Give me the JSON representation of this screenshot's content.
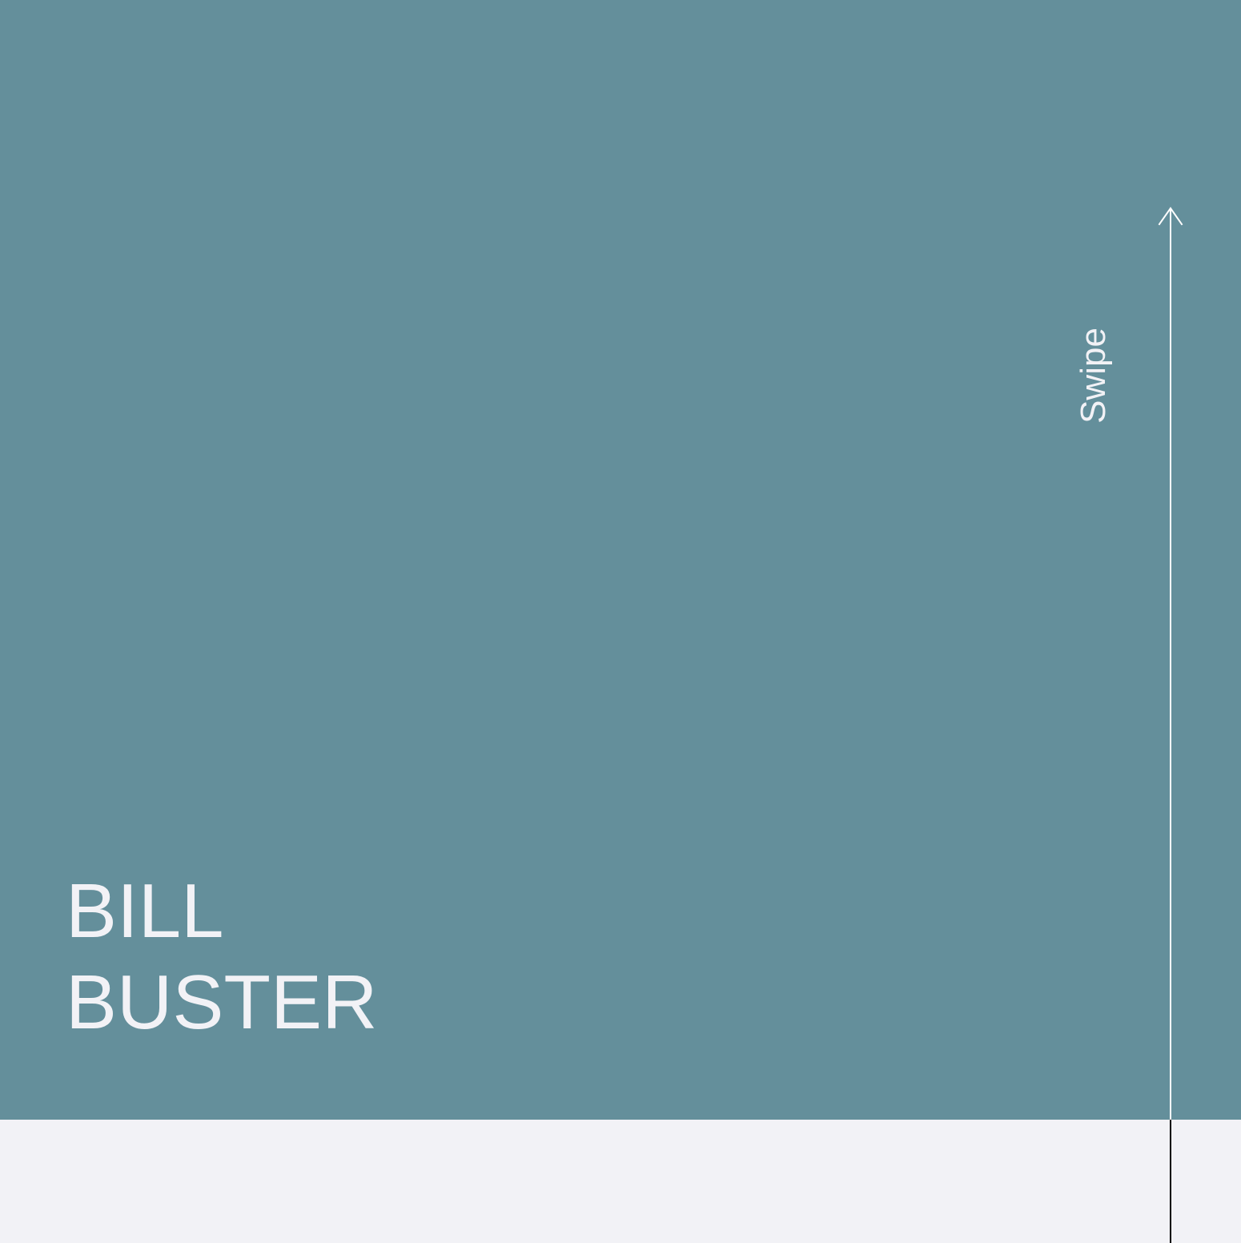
{
  "colors": {
    "hero_background": "#648f9b",
    "bottom_background": "#f2f2f6",
    "text": "#f2f2f6",
    "arrow_on_hero": "#ffffff",
    "arrow_on_bottom": "#000000"
  },
  "title": {
    "line1": "BILL",
    "line2": "BUSTER"
  },
  "swipe": {
    "label": "Swipe",
    "icon": "arrow-up-icon"
  }
}
